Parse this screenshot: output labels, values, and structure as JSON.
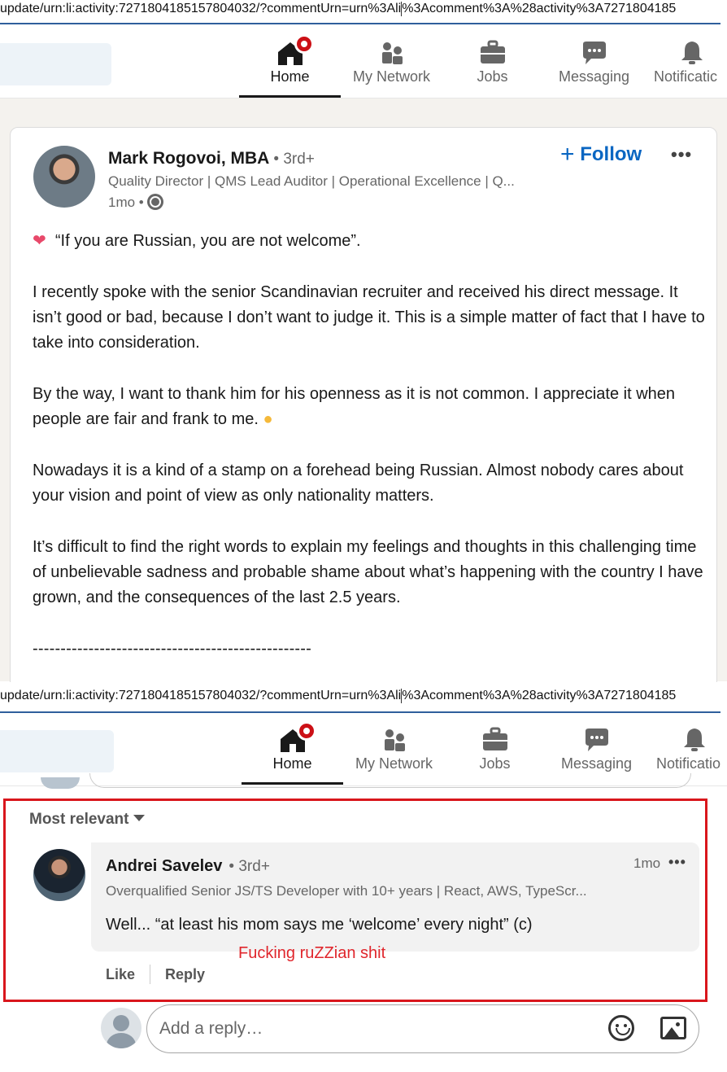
{
  "url": {
    "text_before_caret": "update/urn:li:activity:7271804185157804032/?commentUrn=urn%3Ali",
    "text_after_caret": "%3Acomment%3A%28activity%3A7271804185"
  },
  "nav": {
    "items": [
      {
        "label": "Home",
        "icon": "home-icon"
      },
      {
        "label": "My Network",
        "icon": "people-icon"
      },
      {
        "label": "Jobs",
        "icon": "briefcase-icon"
      },
      {
        "label": "Messaging",
        "icon": "chat-icon"
      },
      {
        "label": "Notifications",
        "icon": "bell-icon"
      }
    ],
    "notifications_label_shown": "Notificatic",
    "notifications_label_shown_2": "Notificatio",
    "accent": "#cc1016"
  },
  "post": {
    "author_name": "Mark Rogovoi, MBA",
    "author_degree": "• 3rd+",
    "author_headline": "Quality Director | QMS Lead Auditor | Operational Excellence | Q...",
    "time": "1mo •",
    "follow_label": "Follow",
    "more_label": "•••",
    "paragraphs": [
      "“If you are Russian, you are not welcome”.",
      "I recently spoke with the senior Scandinavian recruiter and received his direct message. It isn’t good or bad, because I don’t want to judge it. This is a simple matter of fact that I have to take into consideration.",
      "By the way, I want to thank him for his openness as it is not common. I appreciate it when people are fair and frank to me.",
      "Nowadays it is a kind of a stamp on a forehead being Russian. Almost nobody cares about your vision and point of view as only nationality matters.",
      "It’s difficult to find the right words to explain my feelings and thoughts in this challenging time of unbelievable sadness and probable shame about what’s happening with the country I have grown, and the consequences of the last 2.5 years.",
      "--------------------------------------------------"
    ]
  },
  "comments": {
    "sort_label": "Most relevant",
    "comment": {
      "author_name": "Andrei Savelev",
      "author_degree": "• 3rd+",
      "author_headline": "Overqualified Senior JS/TS Developer with 10+ years | React, AWS, TypeScr...",
      "time": "1mo",
      "more_label": "•••",
      "text": "Well... “at least his mom says me ‘welcome’ every night” (c)",
      "like_label": "Like",
      "reply_label": "Reply"
    },
    "annotation": "Fucking ruZZian shit",
    "reply_placeholder": "Add a reply…"
  }
}
